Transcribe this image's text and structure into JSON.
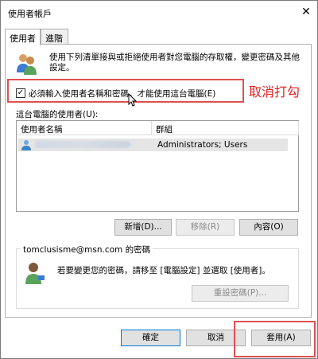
{
  "window": {
    "title": "使用者帳戶",
    "close_glyph": "✕"
  },
  "tabs": [
    {
      "label": "使用者"
    },
    {
      "label": "進階"
    }
  ],
  "description": "使用下列清單接與或拒絕使用者對您電腦的存取權，變更密碼及其他設定。",
  "require_login": {
    "checked": true,
    "check_glyph": "✓",
    "label": "必須輸入使用者名稱和密碼，才能使用這台電腦(E)"
  },
  "annotation": {
    "text": "取消打勾",
    "color": "#e02020"
  },
  "users_list": {
    "label": "這台電腦的使用者(U):",
    "columns": [
      "使用者名稱",
      "群組"
    ],
    "rows": [
      {
        "group": "Administrators; Users"
      }
    ]
  },
  "list_buttons": {
    "add": "新增(D)...",
    "remove": "移除(R)",
    "properties": "內容(O)"
  },
  "password_group": {
    "title": "tomclusisme@msn.com 的密碼",
    "text": "若要變更您的密碼，請移至 [電腦設定] 並選取 [使用者]。",
    "reset_button": "重設密碼(P)..."
  },
  "footer": {
    "ok": "確定",
    "cancel": "取消",
    "apply": "套用(A)"
  },
  "colors": {
    "highlight_border": "#e05050",
    "default_button_border": "#0078d7"
  }
}
